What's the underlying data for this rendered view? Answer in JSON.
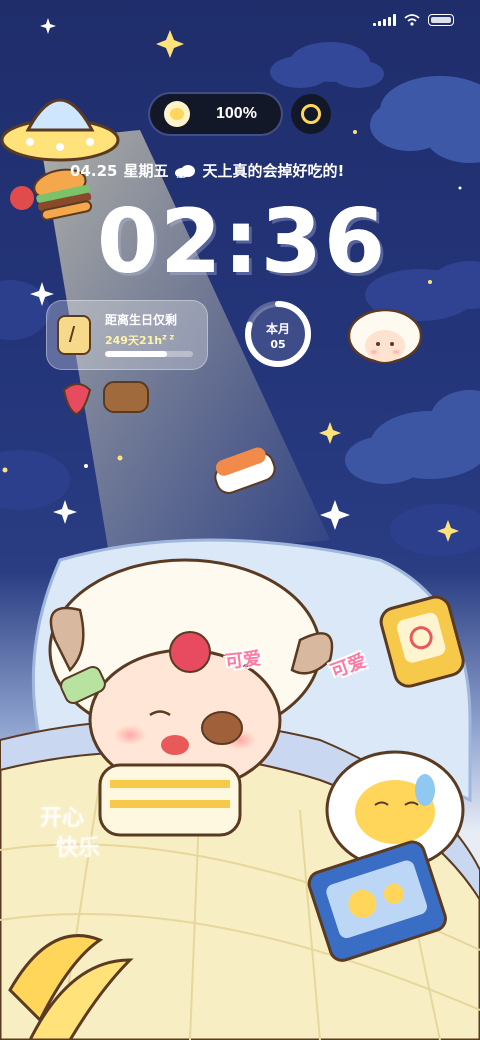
{
  "status_bar": {
    "signal_icon": "signal-bars-icon",
    "wifi_icon": "wifi-icon",
    "battery_icon": "battery-icon"
  },
  "battery_pill": {
    "percent": "100%",
    "icon": "egg-icon"
  },
  "date_line": {
    "date": "04.25",
    "weekday": "星期五",
    "message": "天上真的会掉好吃的!"
  },
  "clock": {
    "time": "02:36"
  },
  "birthday_widget": {
    "title": "距离生日仅剩",
    "countdown": "249天21h",
    "sleep_mark": "z z",
    "progress": 0.7
  },
  "month_widget": {
    "label": "本月",
    "value": "05",
    "progress": 0.8
  },
  "stickers": {
    "cute_1": "可爱",
    "cute_2": "可爱",
    "happy_line1": "开心",
    "happy_line2": "快乐"
  },
  "colors": {
    "sky_top": "#1f2d6b",
    "accent_yellow": "#ffd65a",
    "sticker_pink": "#ff7aa3"
  }
}
